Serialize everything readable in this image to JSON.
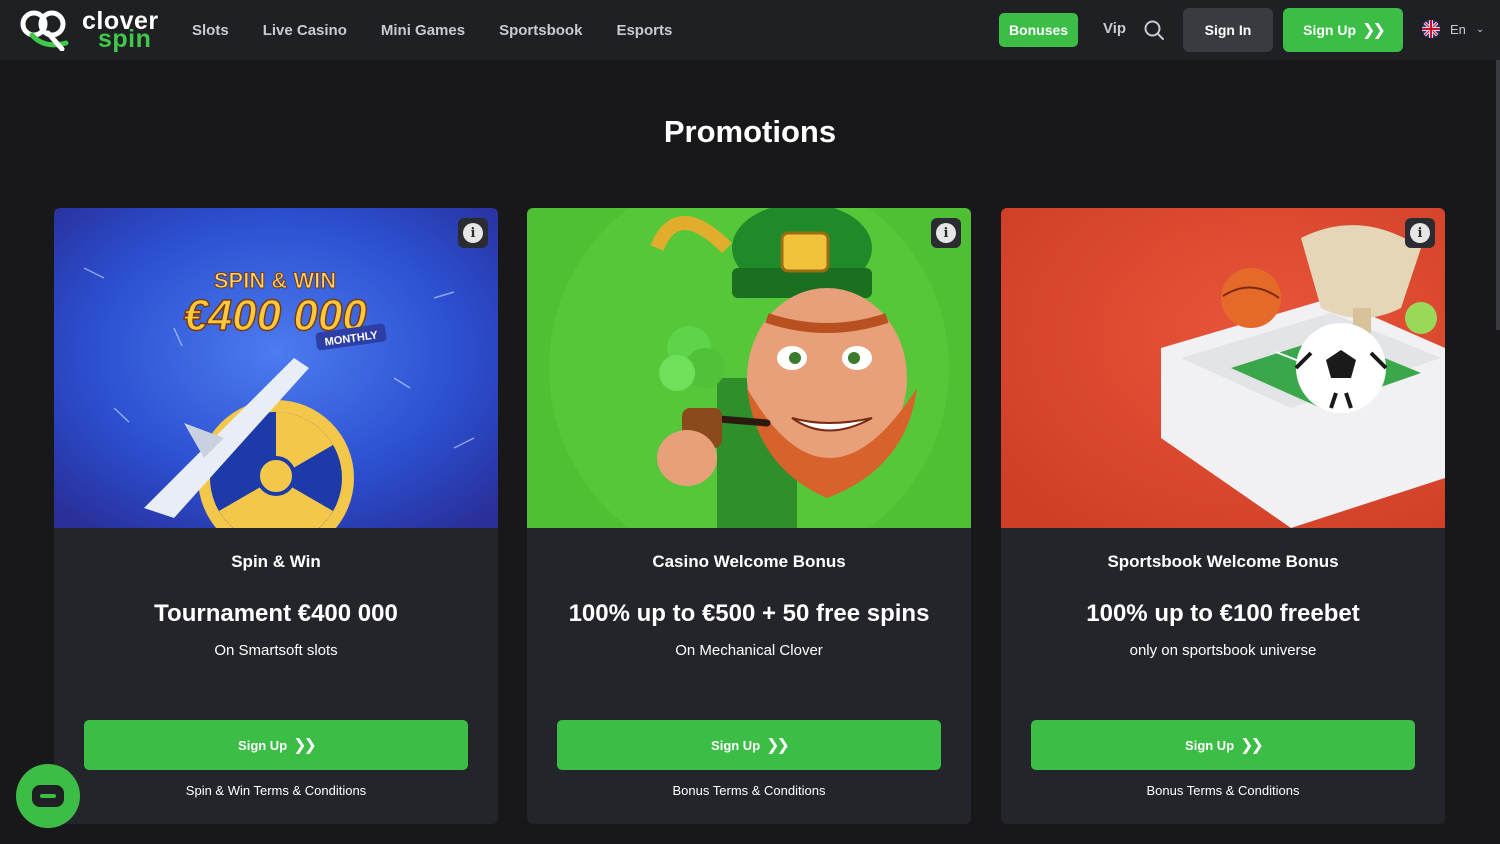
{
  "header": {
    "logo_word1": "clover",
    "logo_word2": "spin",
    "nav": [
      "Slots",
      "Live Casino",
      "Mini Games",
      "Sportsbook",
      "Esports"
    ],
    "bonuses": "Bonuses",
    "vip": "Vip",
    "sign_in": "Sign In",
    "sign_up": "Sign Up",
    "language": "En"
  },
  "main": {
    "title": "Promotions",
    "cards": [
      {
        "title": "Spin & Win",
        "offer": "Tournament €400 000",
        "sub": "On Smartsoft slots",
        "button": "Sign Up",
        "terms": "Spin & Win Terms & Conditions",
        "banner_line1": "SPIN & WIN",
        "banner_line2": "€400 000",
        "banner_tag": "MONTHLY"
      },
      {
        "title": "Casino Welcome Bonus",
        "offer": "100% up to €500 + 50 free spins",
        "sub": "On Mechanical Clover",
        "button": "Sign Up",
        "terms": "Bonus Terms & Conditions"
      },
      {
        "title": "Sportsbook Welcome Bonus",
        "offer": "100% up to €100 freebet",
        "sub": "only on sportsbook universe",
        "button": "Sign Up",
        "terms": "Bonus Terms & Conditions"
      }
    ]
  },
  "colors": {
    "background": "#18181b",
    "header": "#1f2024",
    "card": "#24252b",
    "accent_green": "#3bbd46"
  }
}
